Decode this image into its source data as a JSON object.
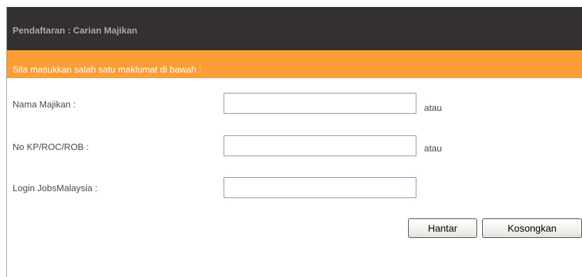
{
  "header": {
    "title": "Pendaftaran : Carian Majikan"
  },
  "instruction": {
    "text": "Sila masukkan salah satu maklumat di bawah :"
  },
  "form": {
    "fields": [
      {
        "label": "Nama Majikan :",
        "value": "",
        "separator": "atau"
      },
      {
        "label": "No KP/ROC/ROB :",
        "value": "",
        "separator": "atau"
      },
      {
        "label": "Login JobsMalaysia :",
        "value": ""
      }
    ],
    "buttons": {
      "submit_label": "Hantar",
      "clear_label": "Kosongkan"
    }
  },
  "colors": {
    "header_bg": "#353030",
    "header_text": "#a8a8a8",
    "instruction_bg": "#fc9d35",
    "instruction_text": "#ffffff",
    "input_border": "#7f9db9"
  }
}
